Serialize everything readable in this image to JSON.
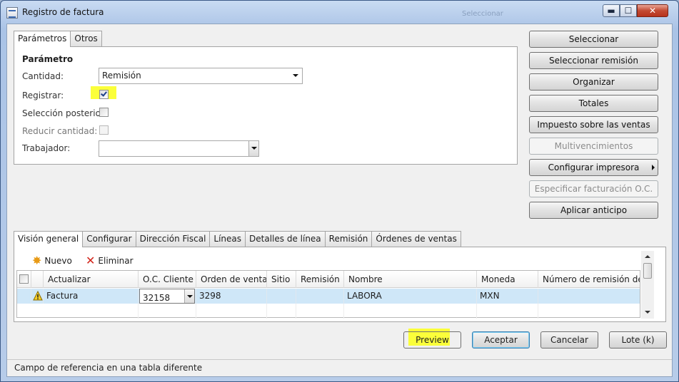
{
  "window": {
    "title": "Registro de factura",
    "ghost_text": "Seleccionar"
  },
  "window_buttons": {
    "minimize": "▬",
    "maximize": "☐",
    "close": "✕"
  },
  "top_tabs": [
    {
      "label": "Parámetros",
      "active": true
    },
    {
      "label": "Otros",
      "active": false
    }
  ],
  "params": {
    "heading": "Parámetro",
    "cantidad_label": "Cantidad:",
    "cantidad_value": "Remisión",
    "registrar_label": "Registrar:",
    "registrar_checked": true,
    "seleccion_label": "Selección posterior:",
    "seleccion_checked": false,
    "reducir_label": "Reducir cantidad:",
    "reducir_checked": false,
    "trabajador_label": "Trabajador:",
    "trabajador_value": ""
  },
  "side_buttons": [
    {
      "label": "Seleccionar",
      "enabled": true
    },
    {
      "label": "Seleccionar remisión",
      "enabled": true
    },
    {
      "label": "Organizar",
      "enabled": true
    },
    {
      "label": "Totales",
      "enabled": true
    },
    {
      "label": "Impuesto sobre las ventas",
      "enabled": true
    },
    {
      "label": "Multivencimientos",
      "enabled": false
    },
    {
      "label": "Configurar impresora",
      "enabled": true
    },
    {
      "label": "Especificar facturación O.C.",
      "enabled": false
    },
    {
      "label": "Aplicar anticipo",
      "enabled": true
    }
  ],
  "lower_tabs": [
    {
      "label": "Visión general",
      "active": true
    },
    {
      "label": "Configurar",
      "active": false
    },
    {
      "label": "Dirección Fiscal",
      "active": false
    },
    {
      "label": "Líneas",
      "active": false
    },
    {
      "label": "Detalles de línea",
      "active": false
    },
    {
      "label": "Remisión",
      "active": false
    },
    {
      "label": "Órdenes de ventas",
      "active": false
    }
  ],
  "grid_toolbar": {
    "new_label": "Nuevo",
    "delete_label": "Eliminar"
  },
  "grid": {
    "columns": [
      "Actualizar",
      "O.C. Cliente",
      "Orden de venta",
      "Sitio",
      "Remisión",
      "Nombre",
      "Moneda",
      "Número de remisión del c"
    ],
    "rows": [
      {
        "actualizar": "Factura",
        "oc_cliente": "32158",
        "orden_venta": "3298",
        "sitio": "",
        "remision": "",
        "nombre": "LABORA",
        "moneda": "MXN",
        "num_remision": ""
      }
    ]
  },
  "bottom_buttons": {
    "preview": "Preview",
    "accept": "Aceptar",
    "cancel": "Cancelar",
    "batch": "Lote (k)"
  },
  "status": {
    "text": "Campo de referencia en una tabla diferente"
  },
  "colors": {
    "highlight": "#fbff3a",
    "selected_row": "#cfe7f8",
    "close_button": "#c34a32"
  }
}
